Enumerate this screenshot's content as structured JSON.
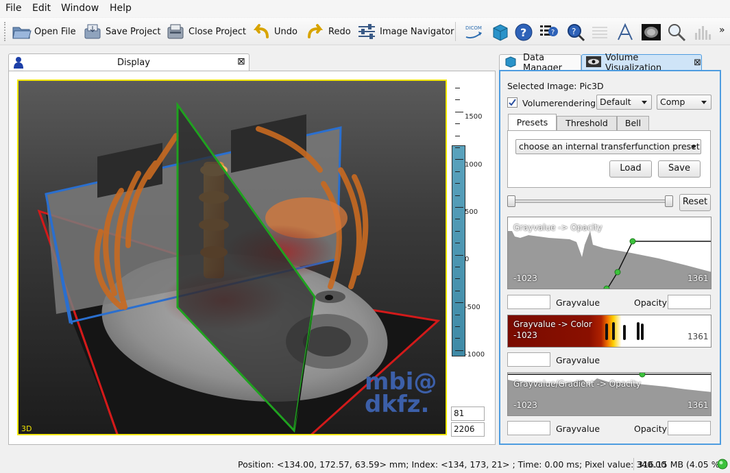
{
  "menu": [
    "File",
    "Edit",
    "Window",
    "Help"
  ],
  "toolbar": {
    "open_file": "Open File",
    "save_project": "Save Project",
    "close_project": "Close Project",
    "undo": "Undo",
    "redo": "Redo",
    "image_navigator": "Image Navigator",
    "dicom_label": "DICOM",
    "overflow": "»"
  },
  "display": {
    "tab_title": "Display",
    "close_glyph": "⊠",
    "view_label": "3D",
    "watermark_line1": "mbi@",
    "watermark_line2": "dkfz."
  },
  "colorbar": {
    "ticks": [
      "1500",
      "1000",
      "500",
      "0",
      "-500",
      "-1000"
    ],
    "level": "81",
    "window": "2206"
  },
  "right": {
    "tabs": {
      "data_manager": "Data Manager",
      "volume_visualization": "Volume Visualization"
    },
    "selected_image": "Selected Image: Pic3D",
    "volumerendering_label": "Volumerendering",
    "volumerendering_checked": true,
    "mode_combo": "Default",
    "comp_combo": "Comp",
    "subtabs": [
      "Presets",
      "Threshold",
      "Bell"
    ],
    "preset_combo": "choose an internal transferfunction preset",
    "load": "Load",
    "save": "Save",
    "reset": "Reset",
    "opacity_graph": {
      "title": "Grayvalue -> Opacity",
      "min": "-1023",
      "max": "1361"
    },
    "opacity_fields": {
      "grayvalue_label": "Grayvalue",
      "opacity_label": "Opacity"
    },
    "color_graph": {
      "title": "Grayvalue -> Color",
      "min": "-1023",
      "max": "1361"
    },
    "color_fields": {
      "grayvalue_label": "Grayvalue"
    },
    "gradient_graph": {
      "title": "Grayvalue/Gradient -> Opacity",
      "min": "-1023",
      "max": "1361"
    },
    "gradient_fields": {
      "grayvalue_label": "Grayvalue",
      "opacity_label": "Opacity"
    }
  },
  "status": {
    "text": "Position: <134.00, 172.57, 63.59> mm; Index: <134, 173, 21> ; Time: 0.00 ms; Pixel value: 340.00",
    "memory": "316.15 MB (4.05 %)"
  },
  "colors": {
    "view_border": "#f2e600",
    "panel_border": "#4d9ce0",
    "colorbar": "#4a93af",
    "plane_green": "#1fa21f",
    "plane_blue": "#2a6fcf",
    "plane_red": "#d21a1a",
    "watermark": "#3c5fa8",
    "status_led": "#3cc23c"
  }
}
